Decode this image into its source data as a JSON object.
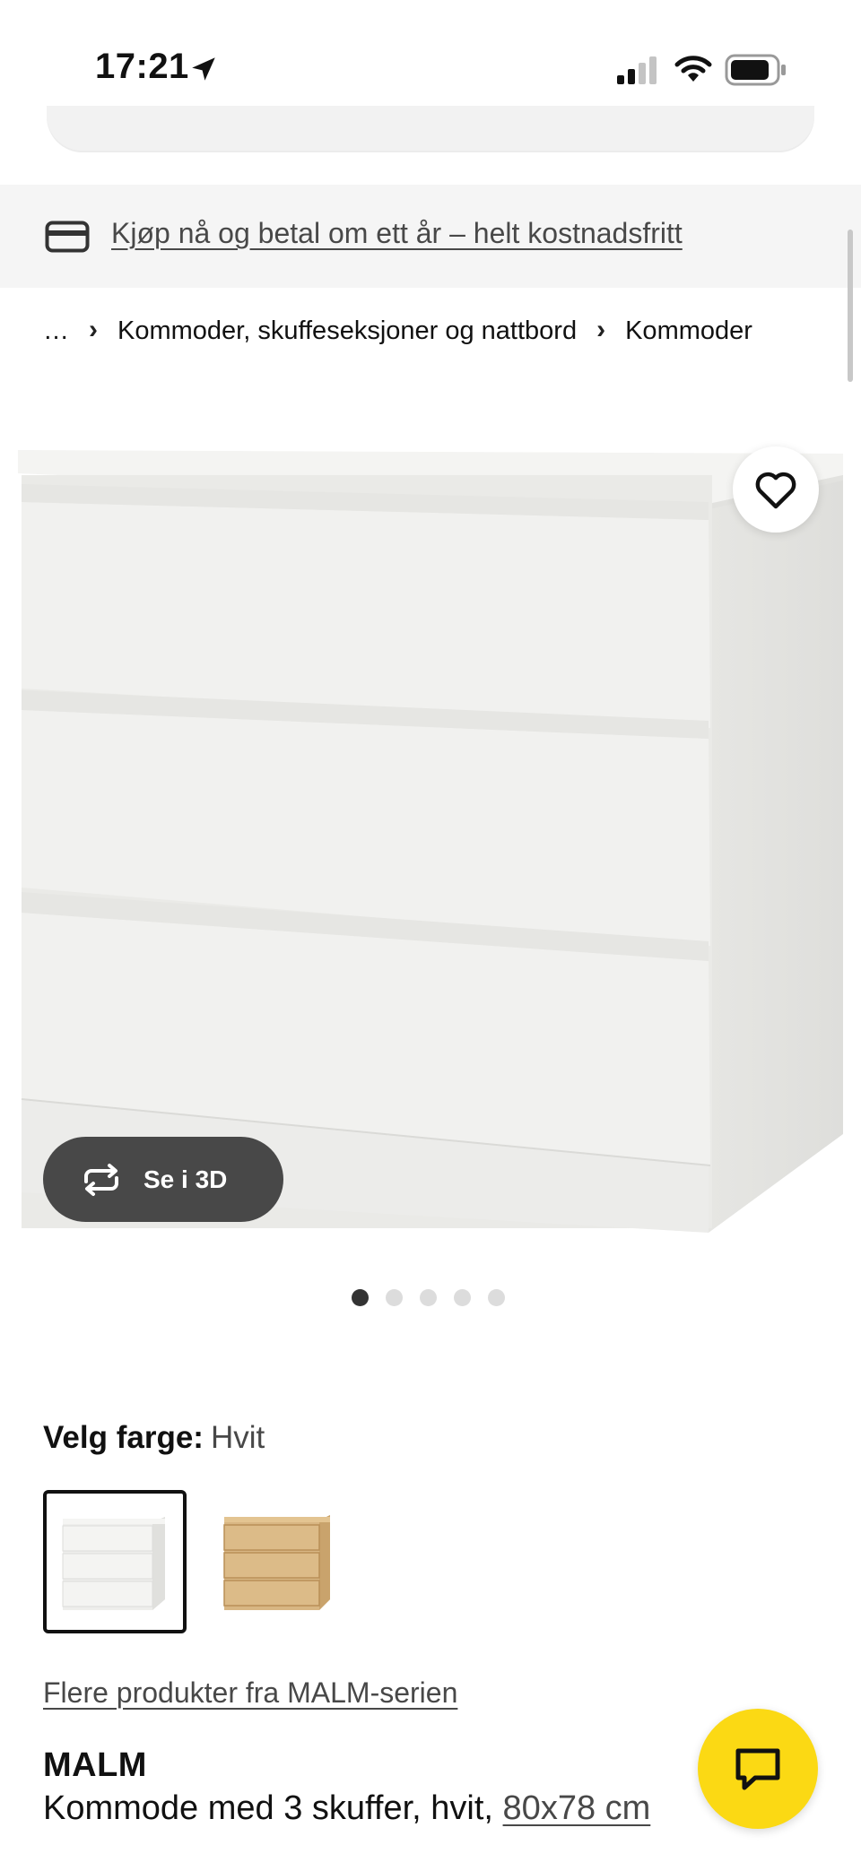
{
  "status_bar": {
    "time": "17:21",
    "location_icon": "location-arrow-icon",
    "signal_icon": "cellular-signal-icon",
    "wifi_icon": "wifi-icon",
    "battery_icon": "battery-icon"
  },
  "banner": {
    "icon": "credit-card-icon",
    "text": "Kjøp nå og betal om ett år – helt kostnadsfritt"
  },
  "breadcrumb": {
    "items": [
      "…",
      "Kommoder, skuffeseksjoner og nattbord",
      "Kommoder"
    ],
    "separator": "›"
  },
  "gallery": {
    "favorite_icon": "heart-icon",
    "view3d_icon": "rotate-3d-icon",
    "view3d_label": "Se i 3D",
    "dot_count": 5,
    "active_dot": 0
  },
  "color_picker": {
    "label": "Velg farge:",
    "selected": "Hvit",
    "options": [
      "Hvit",
      "Hvitbeiset eikefiner"
    ]
  },
  "series_link": "Flere produkter fra MALM-serien",
  "product": {
    "name": "MALM",
    "description": "Kommode med 3 skuffer, hvit, ",
    "dimensions": "80x78 cm"
  },
  "chat": {
    "icon": "chat-bubble-icon"
  },
  "colors": {
    "accent_yellow": "#fbd914",
    "banner_bg": "#f5f5f5",
    "pill_dark": "#484848"
  }
}
